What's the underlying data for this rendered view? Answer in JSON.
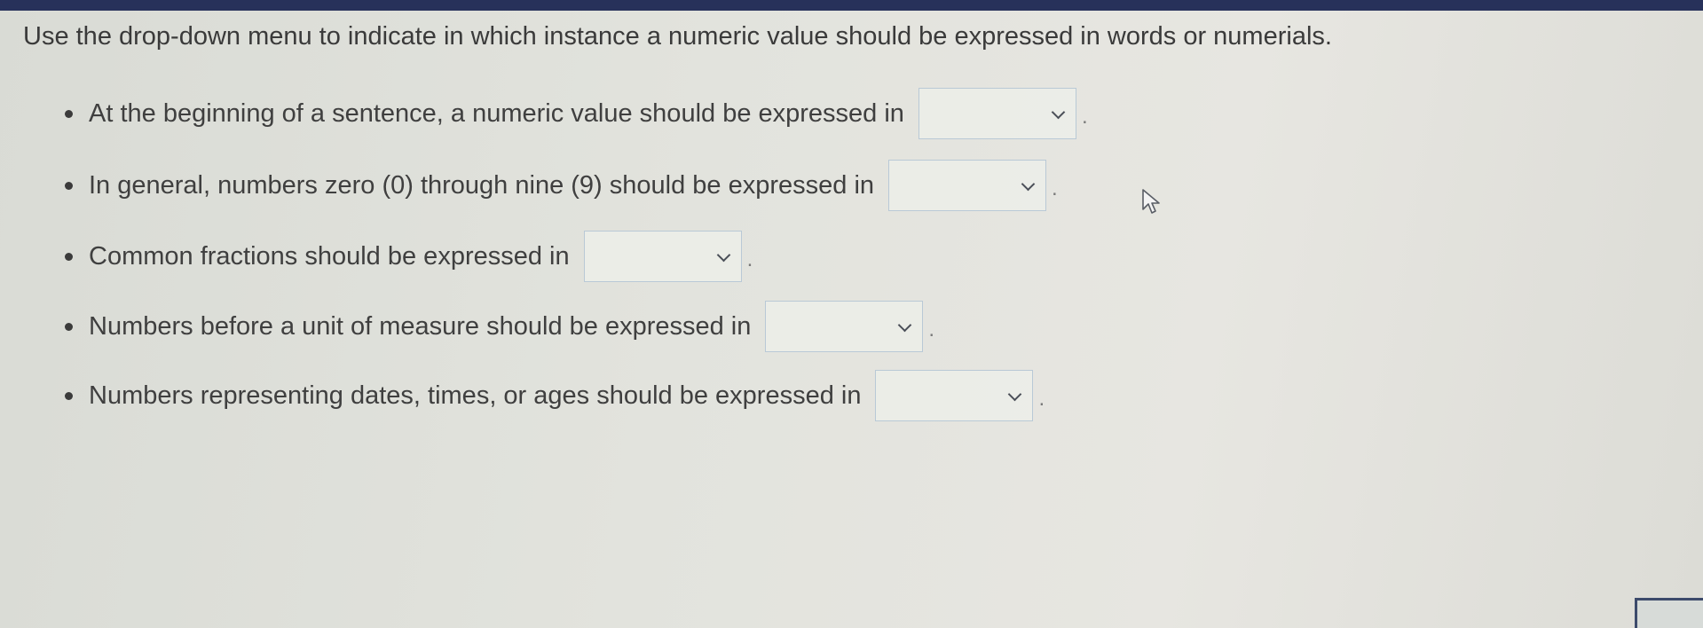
{
  "instructions": "Use the drop-down menu to indicate in which instance a numeric value should be expressed in words or numerials.",
  "questions": [
    {
      "text": "At the beginning of a sentence, a numeric value should be expressed in",
      "selected": "",
      "suffix": "."
    },
    {
      "text": "In general, numbers zero (0) through nine (9) should be expressed in",
      "selected": "",
      "suffix": "."
    },
    {
      "text": "Common fractions should be expressed in",
      "selected": "",
      "suffix": "."
    },
    {
      "text": "Numbers before a unit of measure should be expressed in",
      "selected": "",
      "suffix": "."
    },
    {
      "text": "Numbers representing dates, times, or ages should be expressed in",
      "selected": "",
      "suffix": "."
    }
  ],
  "colors": {
    "top_bar": "#27315a",
    "dropdown_border": "#b9c9d6",
    "text": "#3f3f3f"
  },
  "icons": {
    "dropdown": "chevron-down-icon",
    "cursor": "mouse-pointer-icon"
  }
}
